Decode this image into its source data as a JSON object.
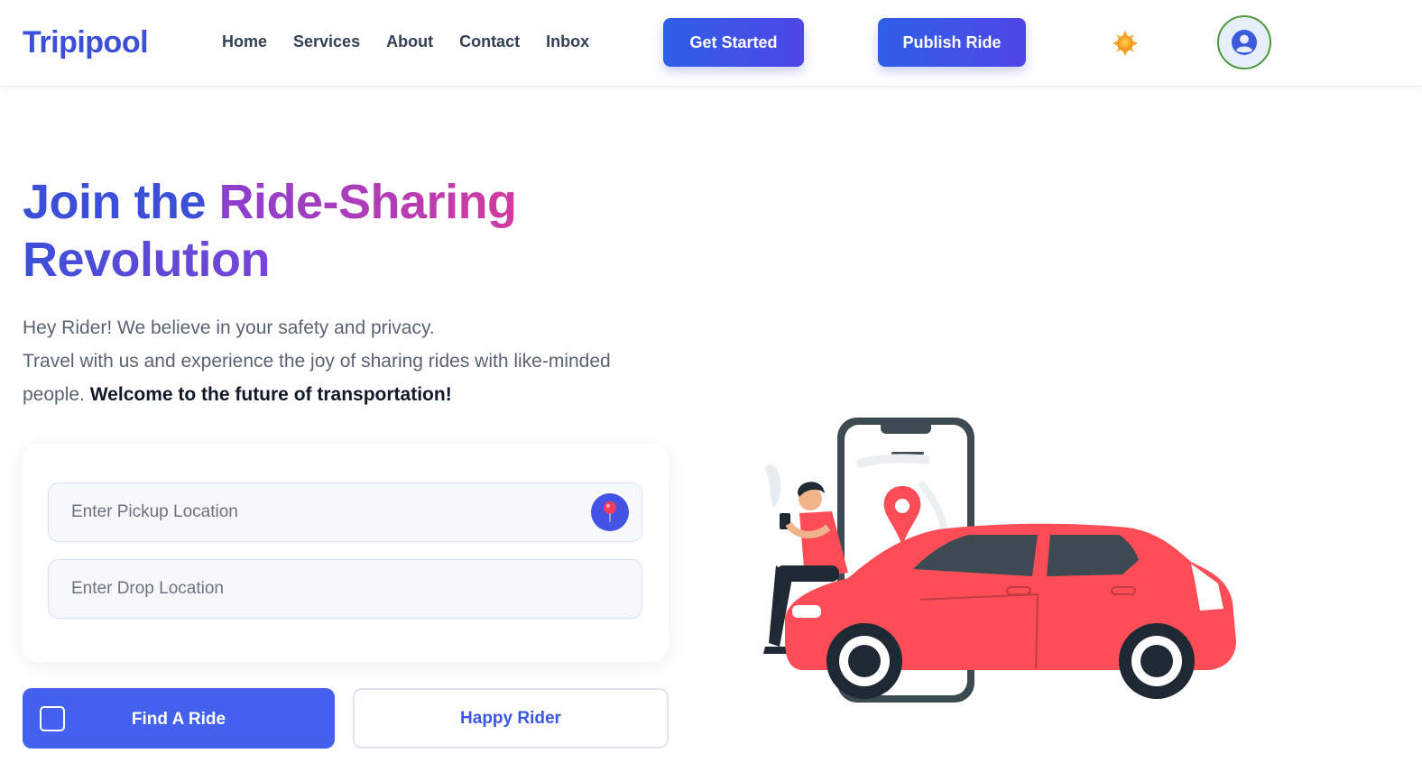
{
  "header": {
    "logo": "Tripipool",
    "nav": [
      {
        "label": "Home"
      },
      {
        "label": "Services"
      },
      {
        "label": "About"
      },
      {
        "label": "Contact"
      },
      {
        "label": "Inbox"
      }
    ],
    "get_started_label": "Get Started",
    "publish_ride_label": "Publish Ride",
    "theme_icon": "sun-icon",
    "profile_icon": "user-circle-icon"
  },
  "hero": {
    "title_part1": "Join the ",
    "title_highlight": "Ride-Sharing",
    "title_part2": "Revolution",
    "line1": "Hey Rider! We believe in your safety and privacy.",
    "line2": "Travel with us and experience the joy of sharing rides with like-minded people. ",
    "line2_strong": "Welcome to the future of transportation!"
  },
  "form": {
    "pickup_placeholder": "Enter Pickup Location",
    "drop_placeholder": "Enter Drop Location",
    "pin_icon": "location-pin-icon"
  },
  "actions": {
    "find_ride_label": "Find A Ride",
    "happy_rider_label": "Happy Rider"
  },
  "colors": {
    "brand": "#3b4fd8",
    "accent_gradient_start": "#8b3fd0",
    "accent_gradient_end": "#d23aa0",
    "button_blue": "#4361ee",
    "car_red": "#ff4d57"
  }
}
